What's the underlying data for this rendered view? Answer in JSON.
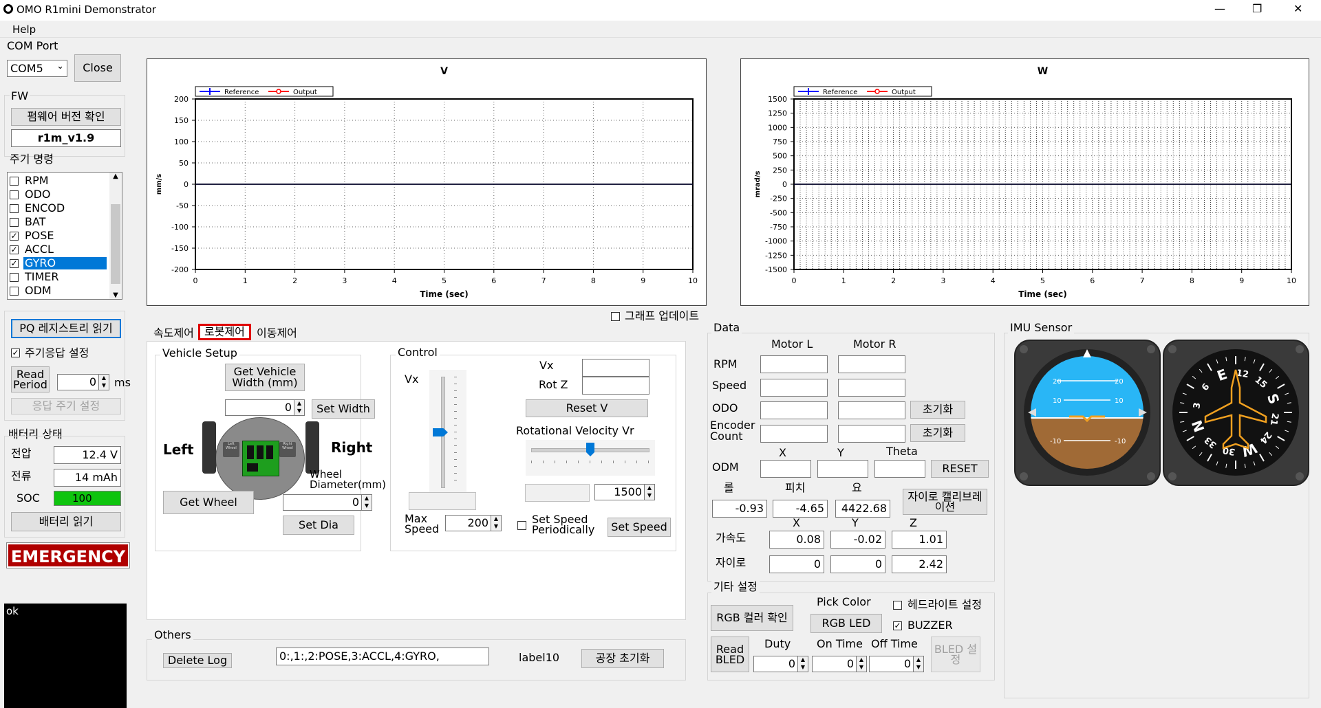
{
  "window": {
    "title": "OMO R1mini Demonstrator",
    "minimize": "—",
    "maximize": "❐",
    "close": "✕"
  },
  "menu": {
    "help": "Help"
  },
  "com": {
    "label": "COM Port",
    "port": "COM5",
    "close_btn": "Close"
  },
  "fw": {
    "label": "FW",
    "check_btn": "펌웨어 버전 확인",
    "version": "r1m_v1.9"
  },
  "periodic": {
    "label": "주기 명령",
    "items": [
      {
        "label": "RPM",
        "checked": false
      },
      {
        "label": "ODO",
        "checked": false
      },
      {
        "label": "ENCOD",
        "checked": false
      },
      {
        "label": "BAT",
        "checked": false
      },
      {
        "label": "POSE",
        "checked": true
      },
      {
        "label": "ACCL",
        "checked": true
      },
      {
        "label": "GYRO",
        "checked": true,
        "selected": true
      },
      {
        "label": "TIMER",
        "checked": false
      },
      {
        "label": "ODM",
        "checked": false
      }
    ]
  },
  "pq": {
    "read_btn": "PQ 레지스트리 읽기",
    "periodic_resp": "주기응답 설정",
    "read_period": "Read\nPeriod",
    "period_value": "0",
    "unit": "ms",
    "set_btn": "응답 주기 설정"
  },
  "battery": {
    "label": "배터리 상태",
    "voltage_label": "전압",
    "voltage": "12.4 V",
    "current_label": "전류",
    "current": "14 mAh",
    "soc_label": "SOC",
    "soc": "100",
    "soc_level": 100,
    "read_btn": "배터리 읽기"
  },
  "emergency": "EMERGENCY",
  "console": {
    "text": "ok"
  },
  "chart_v": {
    "title": "V",
    "ylabel": "mm/s",
    "xlabel": "Time (sec)"
  },
  "chart_w": {
    "title": "W",
    "ylabel": "mrad/s",
    "xlabel": "Time (sec)"
  },
  "chart_data": [
    {
      "type": "line",
      "title": "V",
      "xlabel": "Time (sec)",
      "ylabel": "mm/s",
      "xlim": [
        0,
        10
      ],
      "ylim": [
        -200,
        200
      ],
      "x_ticks": [
        "0",
        "1",
        "2",
        "3",
        "4",
        "5",
        "6",
        "7",
        "8",
        "9",
        "10"
      ],
      "y_ticks": [
        "200",
        "150",
        "100",
        "50",
        "0",
        "-50",
        "-100",
        "-150",
        "-200"
      ],
      "legend": [
        "Reference",
        "Output"
      ],
      "legend_colors": [
        "#0000ff",
        "#ff0000"
      ],
      "grid": true,
      "series": [
        {
          "name": "Reference",
          "x": [
            0,
            10
          ],
          "y": [
            0,
            0
          ]
        },
        {
          "name": "Output",
          "x": [
            0,
            10
          ],
          "y": [
            0,
            0
          ]
        }
      ]
    },
    {
      "type": "line",
      "title": "W",
      "xlabel": "Time (sec)",
      "ylabel": "mrad/s",
      "xlim": [
        0,
        10
      ],
      "ylim": [
        -1500,
        1500
      ],
      "x_ticks": [
        "0",
        "1",
        "2",
        "3",
        "4",
        "5",
        "6",
        "7",
        "8",
        "9",
        "10"
      ],
      "y_ticks": [
        "1500",
        "1250",
        "1000",
        "750",
        "500",
        "250",
        "0",
        "-250",
        "-500",
        "-750",
        "-1000",
        "-1250",
        "-1500"
      ],
      "legend": [
        "Reference",
        "Output"
      ],
      "legend_colors": [
        "#0000ff",
        "#ff0000"
      ],
      "grid": true,
      "series": [
        {
          "name": "Reference",
          "x": [
            0,
            10
          ],
          "y": [
            0,
            0
          ]
        },
        {
          "name": "Output",
          "x": [
            0,
            10
          ],
          "y": [
            0,
            0
          ]
        }
      ]
    }
  ],
  "graph_update": "그래프 업데이트",
  "tabs": {
    "speed": "속도제어",
    "robot": "로봇제어",
    "move": "이동제어",
    "active": "robot"
  },
  "vehicle": {
    "label": "Vehicle Setup",
    "get_width_btn": "Get Vehicle\nWidth (mm)",
    "width_value": "0",
    "set_width_btn": "Set Width",
    "left": "Left",
    "right": "Right",
    "wheel_diam_label": "Wheel\nDiameter(mm)",
    "get_wheel_btn": "Get Wheel",
    "dia_value": "0",
    "set_dia_btn": "Set Dia",
    "robot_left_label": "Left\nWheel",
    "robot_right_label": "Right\nWheel"
  },
  "control": {
    "label": "Control",
    "vx_label": "Vx",
    "vx_right_label": "Vx",
    "rotz_label": "Rot Z",
    "vx_value": "",
    "rotz_value": "",
    "reset_v_btn": "Reset V",
    "rot_vel_label": "Rotational Velocity Vr",
    "max_speed_label": "Max\nSpeed",
    "max_speed": "200",
    "rot_value": "1500",
    "set_speed_periodic": "Set Speed\nPeriodically",
    "set_speed_btn": "Set Speed"
  },
  "others": {
    "label": "Others",
    "delete_log_btn": "Delete Log",
    "log_text": "0:,1:,2:POSE,3:ACCL,4:GYRO,",
    "label10": "label10",
    "factory_reset_btn": "공장 초기화"
  },
  "data": {
    "label": "Data",
    "motor_l": "Motor L",
    "motor_r": "Motor R",
    "rpm_label": "RPM",
    "speed_label": "Speed",
    "odo_label": "ODO",
    "encoder_label": "Encoder\nCount",
    "reset_btn": "초기화",
    "x": "X",
    "y": "Y",
    "theta": "Theta",
    "odm_label": "ODM",
    "odm_reset": "RESET",
    "roll_label": "롤",
    "pitch_label": "피치",
    "yaw_label": "요",
    "roll": "-0.93",
    "pitch": "-4.65",
    "yaw": "4422.68",
    "gyro_calib_btn": "자이로 캘리브레\n이션",
    "z": "Z",
    "accel_label": "가속도",
    "accel_x": "0.08",
    "accel_y": "-0.02",
    "accel_z": "1.01",
    "gyro_label": "자이로",
    "gyro_x": "0",
    "gyro_y": "0",
    "gyro_z": "2.42"
  },
  "etc": {
    "label": "기타 설정",
    "rgb_check_btn": "RGB 컬러 확인",
    "pick_color": "Pick Color",
    "rgb_led_btn": "RGB LED",
    "headlight": "헤드라이트 설정",
    "buzzer": "BUZZER",
    "read_bled_btn": "Read\nBLED",
    "duty_label": "Duty",
    "on_time_label": "On Time",
    "off_time_label": "Off Time",
    "duty": "0",
    "on_time": "0",
    "off_time": "0",
    "bled_set_btn": "BLED 설\n정"
  },
  "imu": {
    "label": "IMU Sensor",
    "attitude_marks": [
      "20",
      "10",
      "10",
      "20",
      "-10",
      "-10"
    ],
    "compass_marks": [
      "E",
      "12",
      "15",
      "S",
      "21",
      "24",
      "W",
      "30",
      "33",
      "N",
      "3",
      "6"
    ]
  },
  "colors": {
    "accent_red": "#e00000",
    "selection": "#0078d7",
    "soc_green": "#0ec40e",
    "sky": "#29b6f6",
    "ground": "#a06a36",
    "plane": "#f0a020"
  }
}
